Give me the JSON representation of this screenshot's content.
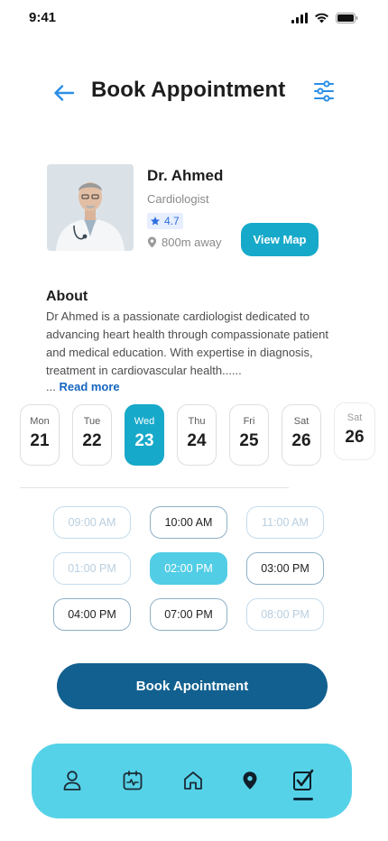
{
  "status_bar": {
    "time": "9:41"
  },
  "header": {
    "title": "Book Appointment"
  },
  "doctor": {
    "name": "Dr. Ahmed",
    "specialty": "Cardiologist",
    "rating": "4.7",
    "distance": "800m away",
    "view_map_label": "View Map"
  },
  "about": {
    "title": "About",
    "text": "Dr Ahmed is a passionate cardiologist dedicated to advancing heart health through compassionate patient and medical education. With expertise in diagnosis, treatment in cardiovascular health......",
    "ellipsis": "...",
    "read_more": "Read more"
  },
  "dates": [
    {
      "day": "Mon",
      "date": "21",
      "selected": false
    },
    {
      "day": "Tue",
      "date": "22",
      "selected": false
    },
    {
      "day": "Wed",
      "date": "23",
      "selected": true
    },
    {
      "day": "Thu",
      "date": "24",
      "selected": false
    },
    {
      "day": "Fri",
      "date": "25",
      "selected": false
    },
    {
      "day": "Sat",
      "date": "26",
      "selected": false
    },
    {
      "day": "Sat",
      "date": "26",
      "selected": false
    }
  ],
  "time_slots": [
    {
      "label": "09:00 AM",
      "state": "disabled"
    },
    {
      "label": "10:00 AM",
      "state": "available"
    },
    {
      "label": "11:00 AM",
      "state": "disabled"
    },
    {
      "label": "01:00 PM",
      "state": "disabled"
    },
    {
      "label": "02:00 PM",
      "state": "selected"
    },
    {
      "label": "03:00 PM",
      "state": "available"
    },
    {
      "label": "04:00 PM",
      "state": "available"
    },
    {
      "label": "07:00 PM",
      "state": "available"
    },
    {
      "label": "08:00 PM",
      "state": "disabled"
    }
  ],
  "book_button_label": "Book Apointment",
  "bottom_nav": {
    "items": [
      "user-icon",
      "calendar-icon",
      "home-icon",
      "location-pin-icon",
      "checklist-icon"
    ],
    "active": "checklist-icon"
  },
  "colors": {
    "accent": "#17a9c9",
    "primary_button": "#12608f",
    "nav_background": "#56d2e8",
    "selected_slot": "#52cde6",
    "link": "#1565c0"
  }
}
